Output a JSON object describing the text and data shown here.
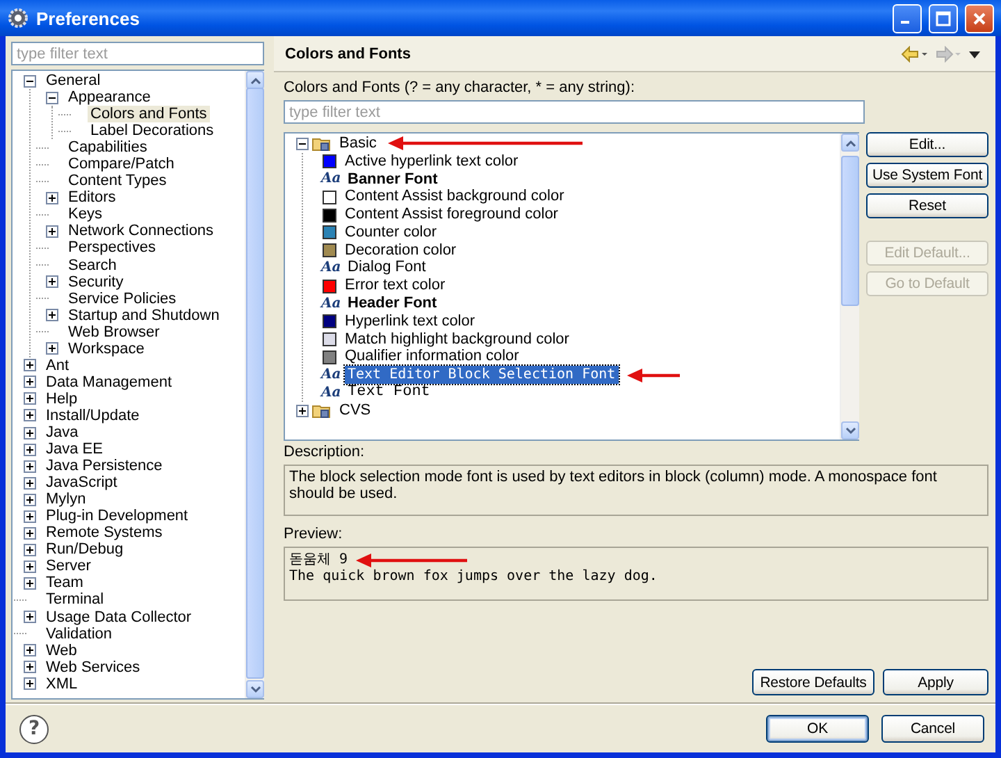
{
  "window": {
    "title": "Preferences"
  },
  "left": {
    "filter": {
      "placeholder": "type filter text"
    },
    "tree": [
      {
        "label": "General",
        "kind": "folder",
        "expanded": true,
        "selected": false,
        "children": [
          {
            "label": "Appearance",
            "kind": "folder",
            "expanded": true,
            "selected": false,
            "children": [
              {
                "label": "Colors and Fonts",
                "kind": "leaf",
                "selected": true
              },
              {
                "label": "Label Decorations",
                "kind": "leaf",
                "selected": false
              }
            ]
          },
          {
            "label": "Capabilities",
            "kind": "leaf",
            "selected": false
          },
          {
            "label": "Compare/Patch",
            "kind": "leaf",
            "selected": false
          },
          {
            "label": "Content Types",
            "kind": "leaf",
            "selected": false
          },
          {
            "label": "Editors",
            "kind": "folder",
            "expanded": false,
            "selected": false
          },
          {
            "label": "Keys",
            "kind": "leaf",
            "selected": false
          },
          {
            "label": "Network Connections",
            "kind": "folder",
            "expanded": false,
            "selected": false
          },
          {
            "label": "Perspectives",
            "kind": "leaf",
            "selected": false
          },
          {
            "label": "Search",
            "kind": "leaf",
            "selected": false
          },
          {
            "label": "Security",
            "kind": "folder",
            "expanded": false,
            "selected": false
          },
          {
            "label": "Service Policies",
            "kind": "leaf",
            "selected": false
          },
          {
            "label": "Startup and Shutdown",
            "kind": "folder",
            "expanded": false,
            "selected": false
          },
          {
            "label": "Web Browser",
            "kind": "leaf",
            "selected": false
          },
          {
            "label": "Workspace",
            "kind": "folder",
            "expanded": false,
            "selected": false
          }
        ]
      },
      {
        "label": "Ant",
        "kind": "folder",
        "expanded": false,
        "selected": false
      },
      {
        "label": "Data Management",
        "kind": "folder",
        "expanded": false,
        "selected": false
      },
      {
        "label": "Help",
        "kind": "folder",
        "expanded": false,
        "selected": false
      },
      {
        "label": "Install/Update",
        "kind": "folder",
        "expanded": false,
        "selected": false
      },
      {
        "label": "Java",
        "kind": "folder",
        "expanded": false,
        "selected": false
      },
      {
        "label": "Java EE",
        "kind": "folder",
        "expanded": false,
        "selected": false
      },
      {
        "label": "Java Persistence",
        "kind": "folder",
        "expanded": false,
        "selected": false
      },
      {
        "label": "JavaScript",
        "kind": "folder",
        "expanded": false,
        "selected": false
      },
      {
        "label": "Mylyn",
        "kind": "folder",
        "expanded": false,
        "selected": false
      },
      {
        "label": "Plug-in Development",
        "kind": "folder",
        "expanded": false,
        "selected": false
      },
      {
        "label": "Remote Systems",
        "kind": "folder",
        "expanded": false,
        "selected": false
      },
      {
        "label": "Run/Debug",
        "kind": "folder",
        "expanded": false,
        "selected": false
      },
      {
        "label": "Server",
        "kind": "folder",
        "expanded": false,
        "selected": false
      },
      {
        "label": "Team",
        "kind": "folder",
        "expanded": false,
        "selected": false
      },
      {
        "label": "Terminal",
        "kind": "leaf",
        "selected": false
      },
      {
        "label": "Usage Data Collector",
        "kind": "folder",
        "expanded": false,
        "selected": false
      },
      {
        "label": "Validation",
        "kind": "leaf",
        "selected": false
      },
      {
        "label": "Web",
        "kind": "folder",
        "expanded": false,
        "selected": false
      },
      {
        "label": "Web Services",
        "kind": "folder",
        "expanded": false,
        "selected": false
      },
      {
        "label": "XML",
        "kind": "folder",
        "expanded": false,
        "selected": false
      }
    ]
  },
  "page": {
    "title": "Colors and Fonts",
    "nav": [
      {
        "kind": "back",
        "disabled": false
      },
      {
        "kind": "forward",
        "disabled": true
      },
      {
        "kind": "menu",
        "disabled": false
      }
    ],
    "filter_label": {
      "text": "Colors and Fonts (? = any character, * = any string):"
    },
    "filter": {
      "placeholder": "type filter text"
    },
    "tree": [
      {
        "label": "Basic",
        "kind": "category",
        "expanded": true,
        "selected": false,
        "marked": true,
        "children": [
          {
            "label": "Active hyperlink text color",
            "kind": "color",
            "color": "#0000ff",
            "selected": false,
            "marked": false
          },
          {
            "label": "Banner Font",
            "kind": "bold-font",
            "icon_text": "Aa",
            "selected": false,
            "marked": false
          },
          {
            "label": "Content Assist background color",
            "kind": "color",
            "color": "#ffffff",
            "selected": false,
            "marked": false
          },
          {
            "label": "Content Assist foreground color",
            "kind": "color",
            "color": "#000000",
            "selected": false,
            "marked": false
          },
          {
            "label": "Counter color",
            "kind": "color",
            "color": "#2a82b4",
            "selected": false,
            "marked": false
          },
          {
            "label": "Decoration color",
            "kind": "color",
            "color": "#a08a50",
            "selected": false,
            "marked": false
          },
          {
            "label": "Dialog Font",
            "kind": "font",
            "icon_text": "Aa",
            "selected": false,
            "marked": false
          },
          {
            "label": "Error text color",
            "kind": "color",
            "color": "#ff0000",
            "selected": false,
            "marked": false
          },
          {
            "label": "Header Font",
            "kind": "bold-font",
            "icon_text": "Aa",
            "selected": false,
            "marked": false
          },
          {
            "label": "Hyperlink text color",
            "kind": "color",
            "color": "#000080",
            "selected": false,
            "marked": false
          },
          {
            "label": "Match highlight background color",
            "kind": "color",
            "color": "#dcdce8",
            "selected": false,
            "marked": false
          },
          {
            "label": "Qualifier information color",
            "kind": "color",
            "color": "#808080",
            "selected": false,
            "marked": false
          },
          {
            "label": "Text Editor Block Selection Font",
            "kind": "mono-font",
            "icon_text": "Aa",
            "selected": true,
            "marked": true
          },
          {
            "label": "Text Font",
            "kind": "fixed-font",
            "icon_text": "Aa",
            "selected": false,
            "marked": false
          }
        ]
      },
      {
        "label": "CVS",
        "kind": "category",
        "expanded": false,
        "selected": false,
        "marked": false
      }
    ],
    "side_buttons": [
      {
        "label": "Edit...",
        "disabled": false
      },
      {
        "label": "Use System Font",
        "disabled": false
      },
      {
        "label": "Reset",
        "disabled": false
      },
      {
        "label": "Edit Default...",
        "disabled": true
      },
      {
        "label": "Go to Default",
        "disabled": true
      }
    ],
    "description_label": {
      "text": "Description:"
    },
    "description": "The block selection mode font is used by text editors in block (column) mode. A monospace font should be used.",
    "preview_label": {
      "text": "Preview:"
    },
    "preview": [
      {
        "text": "돋움체 9",
        "marked": true
      },
      {
        "text": "The quick brown fox jumps over the lazy dog.",
        "marked": false
      }
    ],
    "buttons": [
      {
        "label": "Restore Defaults"
      },
      {
        "label": "Apply"
      }
    ]
  },
  "help": {
    "label": "?"
  },
  "dialog_buttons": [
    {
      "label": "OK",
      "default": true
    },
    {
      "label": "Cancel",
      "default": false
    }
  ]
}
